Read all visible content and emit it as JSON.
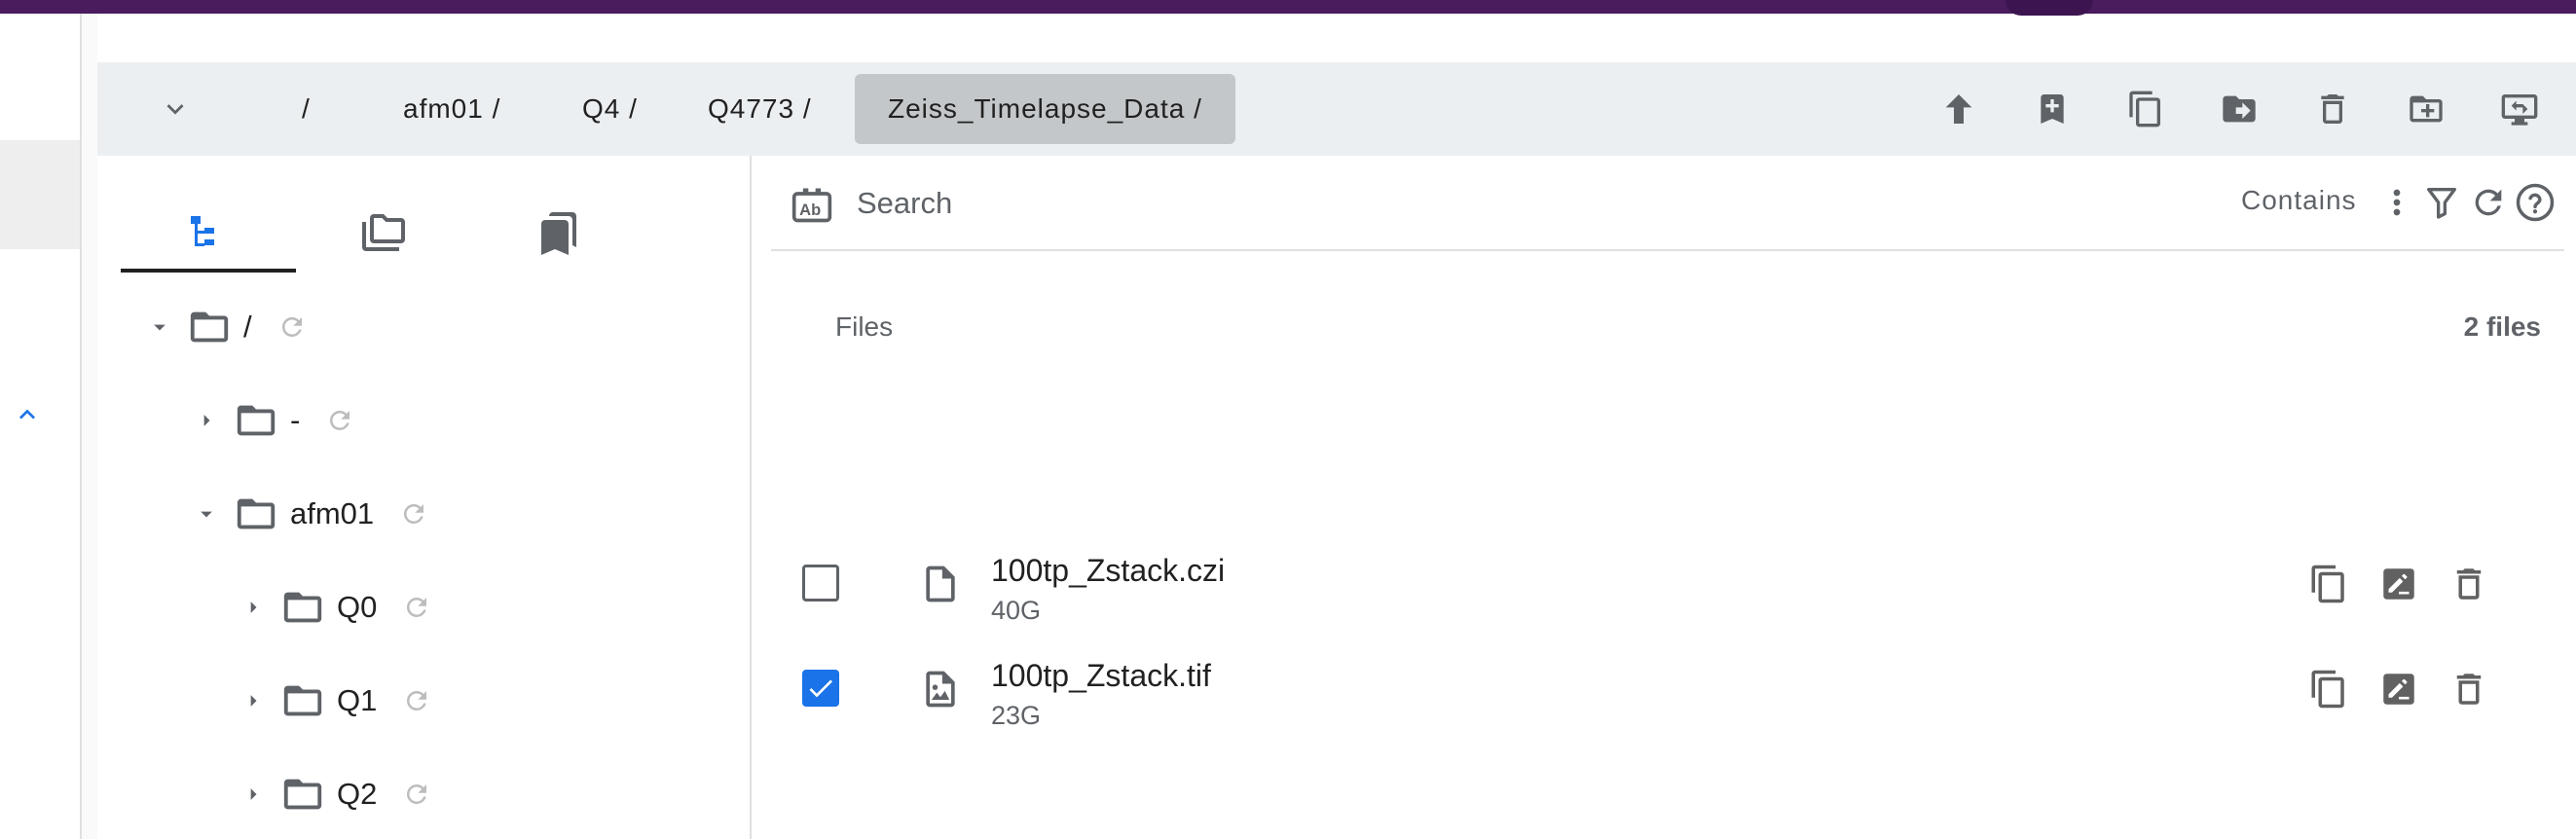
{
  "breadcrumb": {
    "items": [
      {
        "label": "/"
      },
      {
        "label": "afm01 /"
      },
      {
        "label": "Q4 /"
      },
      {
        "label": "Q4773 /"
      },
      {
        "label": "Zeiss_Timelapse_Data /"
      }
    ]
  },
  "toolbar": {
    "icons": [
      "go-up-icon",
      "bookmark-add-icon",
      "copy-icon",
      "move-icon",
      "delete-icon",
      "new-folder-icon",
      "remote-desktop-icon"
    ]
  },
  "nav": {
    "tabs": [
      "tree-view-icon",
      "folders-icon",
      "bookmarks-icon"
    ],
    "active_tab": 0,
    "tree": [
      {
        "label": "/",
        "expanded": true
      },
      {
        "label": "-",
        "expanded": false
      },
      {
        "label": "afm01",
        "expanded": true
      },
      {
        "label": "Q0",
        "expanded": false
      },
      {
        "label": "Q1",
        "expanded": false
      },
      {
        "label": "Q2",
        "expanded": false
      }
    ]
  },
  "search": {
    "placeholder": "Search",
    "mode_label": "Contains"
  },
  "files": {
    "header": "Files",
    "count": "2 files",
    "rows": [
      {
        "name": "100tp_Zstack.czi",
        "size": "40G",
        "checked": false,
        "icon": "file-icon"
      },
      {
        "name": "100tp_Zstack.tif",
        "size": "23G",
        "checked": true,
        "icon": "image-file-icon"
      }
    ]
  },
  "colors": {
    "topbar": "#4a1c5e",
    "accent": "#1a73e8",
    "crumbbar": "#eceff1",
    "active_crumb": "#c4c7c9"
  }
}
